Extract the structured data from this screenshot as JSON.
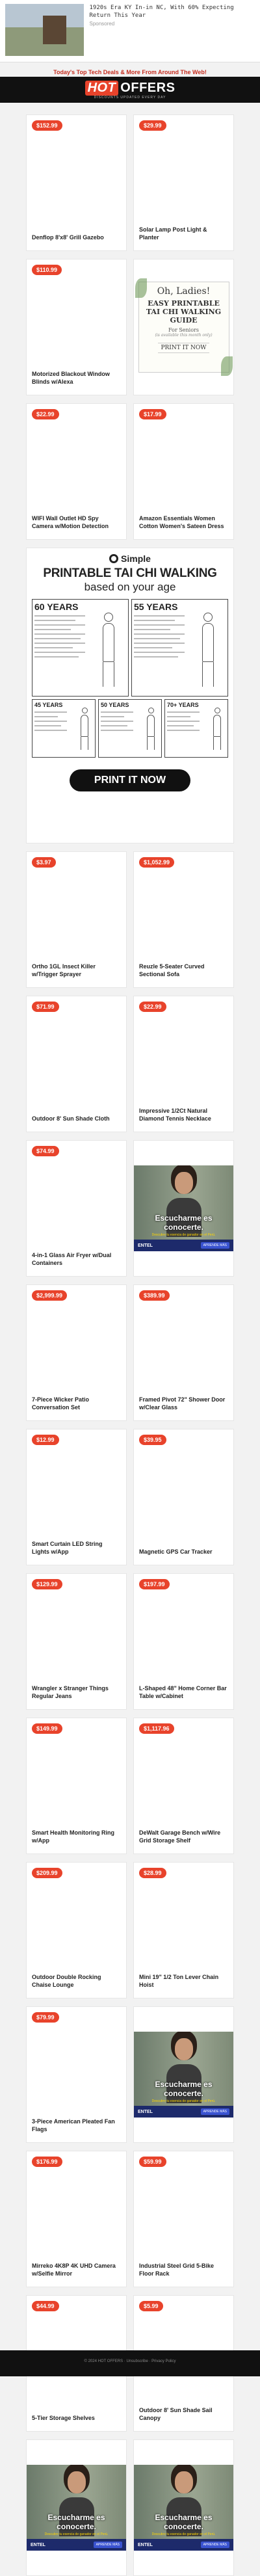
{
  "top_ad": {
    "text": "1920s Era KY In-in NC, With 60% Expecting Return This Year",
    "sponsor": "Sponsored"
  },
  "banner": {
    "text": "Today's Top Tech Deals & More From Around The Web!"
  },
  "logo": {
    "hot": "HOT",
    "offers": "OFFERS",
    "tagline": "DISCOUNTS UPDATED EVERY DAY"
  },
  "tai_chi_card": {
    "line1": "Oh, Ladies!",
    "line2": "EASY PRINTABLE TAI CHI WALKING GUIDE",
    "line3": "For Seniors",
    "line4": "(is available this month only)",
    "line5": "PRINT IT NOW"
  },
  "big_ad": {
    "brand": "Simple",
    "title": "PRINTABLE TAI CHI WALKING",
    "subtitle": "based on your age",
    "ages_top": [
      "60 YEARS",
      "55 YEARS"
    ],
    "ages_bottom": [
      "45 YEARS",
      "50 YEARS",
      "70+ YEARS"
    ],
    "button": "PRINT IT NOW"
  },
  "video_ad": {
    "caption": "Escucharme es conocerte.",
    "subcaption": "Descubre tu esencia de ganador en el Perú.",
    "brand": "ENTEL",
    "cta": "APRENDE MÁS"
  },
  "products_1": [
    {
      "price": "$152.99",
      "name": "Denflop 8'x8' Grill Gazebo"
    },
    {
      "price": "$29.99",
      "name": "Solar Lamp Post Light & Planter"
    },
    {
      "price": "$110.99",
      "name": "Motorized Blackout Window Blinds w/Alexa"
    }
  ],
  "products_2": [
    {
      "price": "$22.99",
      "name": "WIFI Wall Outlet HD Spy Camera w/Motion Detection"
    },
    {
      "price": "$17.99",
      "name": "Amazon Essentials Women Cotton Women's Sateen Dress"
    }
  ],
  "products_3": [
    {
      "price": "$3.97",
      "name": "Ortho 1GL Insect Killer w/Trigger Sprayer"
    },
    {
      "price": "$1,052.99",
      "name": "Reuzle 5-Seater Curved Sectional Sofa"
    },
    {
      "price": "$71.99",
      "name": "Outdoor 8' Sun Shade Cloth"
    },
    {
      "price": "$22.99",
      "name": "Impressive 1/2Ct Natural Diamond Tennis Necklace"
    },
    {
      "price": "$74.99",
      "name": "4-in-1 Glass Air Fryer w/Dual Containers"
    }
  ],
  "products_4": [
    {
      "price": "$2,999.99",
      "name": "7-Piece Wicker Patio Conversation Set"
    },
    {
      "price": "$389.99",
      "name": "Framed Pivot 72\" Shower Door w/Clear Glass"
    },
    {
      "price": "$12.99",
      "name": "Smart Curtain LED String Lights w/App"
    },
    {
      "price": "$39.95",
      "name": "Magnetic GPS Car Tracker"
    },
    {
      "price": "$129.99",
      "name": "Wrangler x Stranger Things Regular Jeans"
    },
    {
      "price": "$197.99",
      "name": "L-Shaped 48\" Home Corner Bar Table w/Cabinet"
    },
    {
      "price": "$149.99",
      "name": "Smart Health Monitoring Ring w/App"
    },
    {
      "price": "$1,117.96",
      "name": "DeWalt Garage Bench w/Wire Grid Storage Shelf"
    },
    {
      "price": "$209.99",
      "name": "Outdoor Double Rocking Chaise Lounge"
    },
    {
      "price": "$28.99",
      "name": "Mini 19\" 1/2 Ton Lever Chain Hoist"
    },
    {
      "price": "$79.99",
      "name": "3-Piece American Pleated Fan Flags"
    }
  ],
  "products_5": [
    {
      "price": "$176.99",
      "name": "Mirreko 4K8P 4K UHD Camera w/Selfie Mirror"
    },
    {
      "price": "$59.99",
      "name": "Industrial Steel Grid 5-Bike Floor Rack"
    },
    {
      "price": "$44.99",
      "name": "5-Tier Storage Shelves"
    },
    {
      "price": "$5.99",
      "name": "Outdoor 8' Sun Shade Sail Canopy"
    }
  ],
  "footer": {
    "text": "© 2024 HOT OFFERS · Unsubscribe · Privacy Policy"
  }
}
